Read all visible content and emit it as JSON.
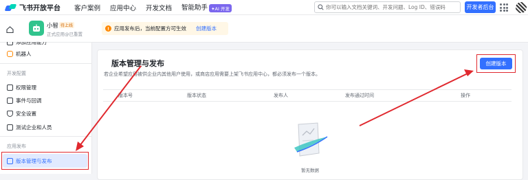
{
  "topbar": {
    "logo_text": "飞书开放平台",
    "nav": [
      "客户案例",
      "应用中心",
      "开发文档",
      "智能助手"
    ],
    "ai_badge": "✦AI 开发",
    "search_placeholder": "你可以输入文档关键词、开发问题、Log ID、错误码",
    "developer_button": "开发者后台"
  },
  "app": {
    "name": "小智",
    "status": "待上线",
    "subtitle": "正式应用@已重置"
  },
  "notice": {
    "text": "应用发布后，当前配置方可生效",
    "link": "创建版本"
  },
  "sidebar": {
    "partial_item": "添加应用能力",
    "bot_item": "机器人",
    "section_dev": "开发配置",
    "items": [
      "权限管理",
      "事件与回调",
      "安全设置",
      "测试企业和人员"
    ],
    "section_release": "应用发布",
    "active_item": "版本管理与发布"
  },
  "main": {
    "title": "版本管理与发布",
    "description": "若企业希望应用被供企业内其他用户使用，或商店应用需要上架飞书应用中心，都必须发布一个版本。",
    "create_button": "创建版本",
    "columns": [
      "版本号",
      "版本状态",
      "发布人",
      "发布通过时间",
      "操作"
    ],
    "empty_text": "暂无数据"
  },
  "colors": {
    "accent": "#3370ff",
    "annotation_red": "#e0282e"
  }
}
